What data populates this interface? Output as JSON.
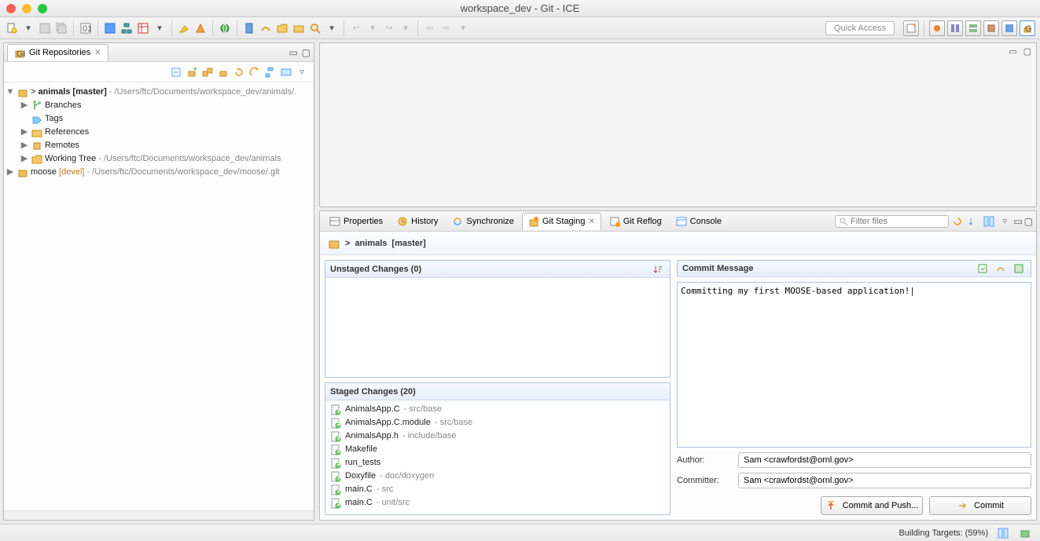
{
  "window": {
    "title": "workspace_dev - Git - ICE"
  },
  "toolbar": {
    "quick_access": "Quick Access"
  },
  "repoView": {
    "tab": "Git Repositories",
    "items": {
      "animals_prefix": "> ",
      "animals_name": "animals",
      "animals_branch": " [master]",
      "animals_path": " - /Users/ftc/Documents/workspace_dev/animals/.",
      "branches": "Branches",
      "tags": "Tags",
      "references": "References",
      "remotes": "Remotes",
      "working_tree": "Working Tree",
      "working_tree_path": " - /Users/ftc/Documents/workspace_dev/animals",
      "moose_name": "moose",
      "moose_branch": " [devel]",
      "moose_path": " - /Users/ftc/Documents/workspace_dev/moose/.git"
    }
  },
  "bottomTabs": {
    "properties": "Properties",
    "history": "History",
    "synchronize": "Synchronize",
    "gitstaging": "Git Staging",
    "gitreflog": "Git Reflog",
    "console": "Console",
    "filter_ph": "Filter files"
  },
  "staging": {
    "repo_prefix": "> ",
    "repo_name": "animals",
    "repo_branch": " [master]",
    "unstaged_hdr": "Unstaged Changes (0)",
    "staged_hdr": "Staged Changes (20)",
    "commit_hdr": "Commit Message",
    "commit_msg": "Committing my first MOOSE-based application!",
    "author_lbl": "Author:",
    "committer_lbl": "Committer:",
    "author": "Sam <crawfordst@ornl.gov>",
    "committer": "Sam <crawfordst@ornl.gov>",
    "commit_push": "Commit and Push...",
    "commit": "Commit",
    "files": [
      {
        "name": "AnimalsApp.C",
        "path": " - src/base"
      },
      {
        "name": "AnimalsApp.C.module",
        "path": " - src/base"
      },
      {
        "name": "AnimalsApp.h",
        "path": " - include/base"
      },
      {
        "name": "Makefile",
        "path": ""
      },
      {
        "name": "run_tests",
        "path": ""
      },
      {
        "name": "Doxyfile",
        "path": " - doc/doxygen"
      },
      {
        "name": "main.C",
        "path": " - src"
      },
      {
        "name": "main.C",
        "path": " - unit/src"
      }
    ]
  },
  "status": {
    "building": "Building Targets: (59%)"
  }
}
